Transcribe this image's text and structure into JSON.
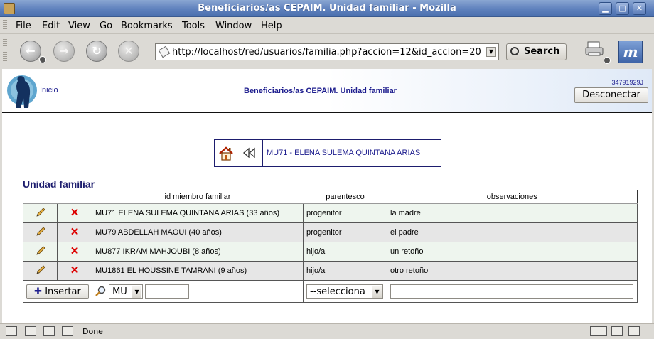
{
  "window": {
    "title": "Beneficiarios/as CEPAIM. Unidad familiar - Mozilla",
    "controls": [
      "▁",
      "□",
      "✕"
    ]
  },
  "menu": [
    "File",
    "Edit",
    "View",
    "Go",
    "Bookmarks",
    "Tools",
    "Window",
    "Help"
  ],
  "toolbar": {
    "url": "http://localhost/red/usuarios/familia.php?accion=12&id_accion=20",
    "search_label": "Search",
    "logo_letter": "m"
  },
  "header": {
    "home_link": "Inicio",
    "title": "Beneficiarios/as CEPAIM. Unidad familiar",
    "user_id": "34791929J",
    "disconnect_label": "Desconectar"
  },
  "member_nav": {
    "current_member": "MU71 - ELENA SULEMA QUINTANA ARIAS"
  },
  "family": {
    "section_title": "Unidad familiar",
    "columns": [
      "id miembro familiar",
      "parentesco",
      "observaciones"
    ],
    "rows": [
      {
        "member": "MU71 ELENA SULEMA QUINTANA ARIAS (33 años)",
        "relation": "progenitor",
        "notes": "la madre"
      },
      {
        "member": "MU79 ABDELLAH MAOUI (40 años)",
        "relation": "progenitor",
        "notes": "el padre"
      },
      {
        "member": "MU877 IKRAM MAHJOUBI (8 años)",
        "relation": "hijo/a",
        "notes": "un retoño"
      },
      {
        "member": "MU1861 EL HOUSSINE TAMRANI (9 años)",
        "relation": "hijo/a",
        "notes": "otro retoño"
      }
    ],
    "insert_label": "Insertar",
    "prefix_value": "MU",
    "relation_select": "--selecciona"
  },
  "status": {
    "text": "Done"
  },
  "colors": {
    "link": "#1d1d8e",
    "delete": "#dd0000",
    "row_odd": "#eef5ee",
    "row_even": "#e6e6e6"
  }
}
